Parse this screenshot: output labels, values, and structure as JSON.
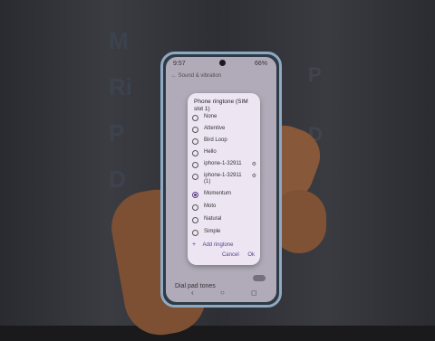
{
  "status": {
    "time": "9:57",
    "battery": "66%"
  },
  "settings_header": "Sound & vibration",
  "background_letters": [
    "M",
    "Ri",
    "P",
    "D",
    "P",
    "D"
  ],
  "dialog": {
    "title": "Phone ringtone (SIM slot 1)",
    "options": [
      {
        "label": "None",
        "selected": false,
        "gear": false
      },
      {
        "label": "Attentive",
        "selected": false,
        "gear": false
      },
      {
        "label": "Bird Loop",
        "selected": false,
        "gear": false
      },
      {
        "label": "Hello",
        "selected": false,
        "gear": false
      },
      {
        "label": "iphone-1-32911",
        "selected": false,
        "gear": true
      },
      {
        "label": "iphone-1-32911 (1)",
        "selected": false,
        "gear": true
      },
      {
        "label": "Momentum",
        "selected": true,
        "gear": false
      },
      {
        "label": "Moto",
        "selected": false,
        "gear": false
      },
      {
        "label": "Natural",
        "selected": false,
        "gear": false
      },
      {
        "label": "Simple",
        "selected": false,
        "gear": false
      }
    ],
    "add_label": "Add ringtone",
    "cancel_label": "Cancel",
    "ok_label": "Ok"
  },
  "dial_pad_label": "Dial pad tones",
  "icons": {
    "back": "back-icon",
    "home": "home-icon",
    "recents": "recents-icon",
    "gear": "gear-icon",
    "add": "plus-icon"
  },
  "colors": {
    "accent": "#5a3e8c",
    "dialog_bg": "#ede6f2",
    "phone_frame": "#8ea9c4"
  }
}
